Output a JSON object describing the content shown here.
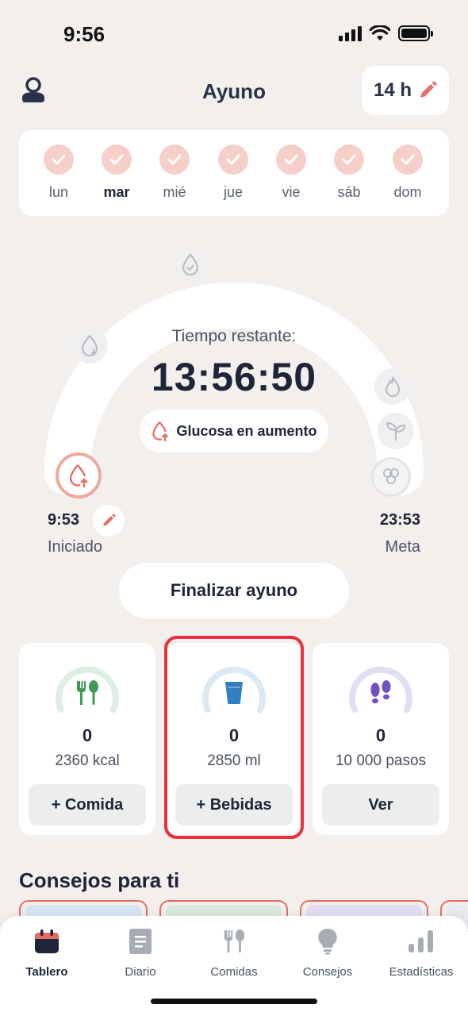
{
  "status_bar": {
    "time": "9:56"
  },
  "header": {
    "title": "Ayuno",
    "hours_label": "14 h"
  },
  "week": {
    "days": [
      {
        "label": "lun",
        "bold": false
      },
      {
        "label": "mar",
        "bold": true
      },
      {
        "label": "mié",
        "bold": false
      },
      {
        "label": "jue",
        "bold": false
      },
      {
        "label": "vie",
        "bold": false
      },
      {
        "label": "sáb",
        "bold": false
      },
      {
        "label": "dom",
        "bold": false
      }
    ]
  },
  "fasting": {
    "remaining_caption": "Tiempo restante:",
    "remaining_time": "13:56:50",
    "stage_label": "Glucosa en aumento",
    "start_time": "9:53",
    "start_label": "Iniciado",
    "goal_time": "23:53",
    "goal_label": "Meta",
    "end_button": "Finalizar ayuno"
  },
  "trackers": {
    "food": {
      "count": "0",
      "goal": "2360 kcal",
      "button": "+ Comida",
      "color": "#3f9a55"
    },
    "drinks": {
      "count": "0",
      "goal": "2850 ml",
      "button": "+ Bebidas",
      "color": "#2f7fc1"
    },
    "steps": {
      "count": "0",
      "goal": "10 000 pasos",
      "button": "Ver",
      "color": "#7250c8"
    }
  },
  "tips": {
    "title": "Consejos para ti"
  },
  "tabbar": {
    "tabs": [
      {
        "label": "Tablero",
        "active": true
      },
      {
        "label": "Diario",
        "active": false
      },
      {
        "label": "Comidas",
        "active": false
      },
      {
        "label": "Consejos",
        "active": false
      },
      {
        "label": "Estadísticas",
        "active": false
      }
    ]
  },
  "colors": {
    "accent": "#e66d63",
    "highlight": "#ea2f3b",
    "background": "#f3efed"
  }
}
